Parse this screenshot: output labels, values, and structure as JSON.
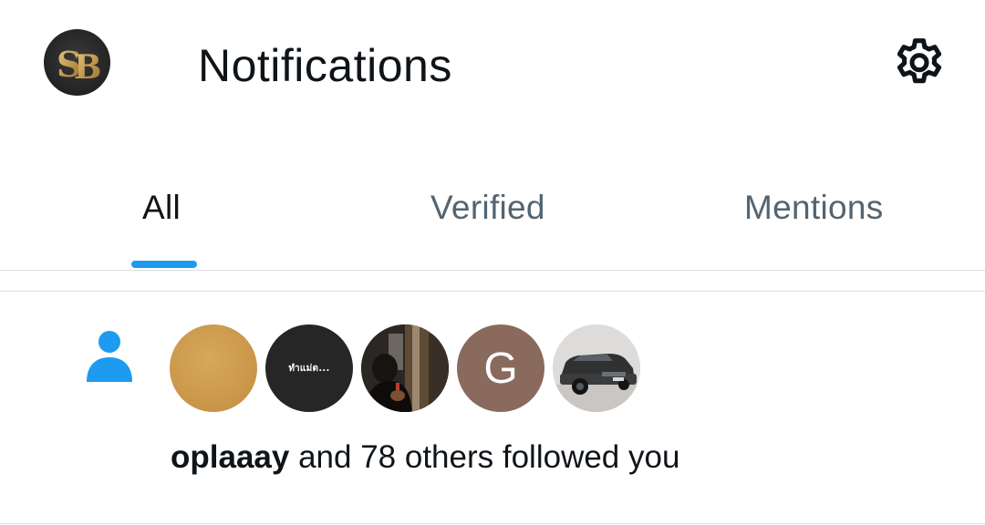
{
  "header": {
    "title": "Notifications",
    "avatar_icon": "account-avatar-sb-logo",
    "settings_icon": "gear-icon"
  },
  "tabs": [
    {
      "label": "All",
      "active": true
    },
    {
      "label": "Verified",
      "active": false
    },
    {
      "label": "Mentions",
      "active": false
    }
  ],
  "notification": {
    "type": "follow",
    "icon": "person-icon",
    "username": "oplaaay",
    "text": " and 78 others followed you",
    "avatars": [
      {
        "kind": "photo",
        "color": "#c99649"
      },
      {
        "kind": "photo",
        "color": "#262626",
        "caption": "ทำแม่ต..."
      },
      {
        "kind": "photo",
        "color": "#2c2a27"
      },
      {
        "kind": "letter",
        "letter": "G",
        "color": "#8a6a5c"
      },
      {
        "kind": "photo",
        "color": "#dcdcdc"
      }
    ]
  },
  "colors": {
    "accent": "#1d9bf0",
    "text_primary": "#0f1419",
    "text_secondary": "#536471",
    "divider": "#d9dee2"
  }
}
